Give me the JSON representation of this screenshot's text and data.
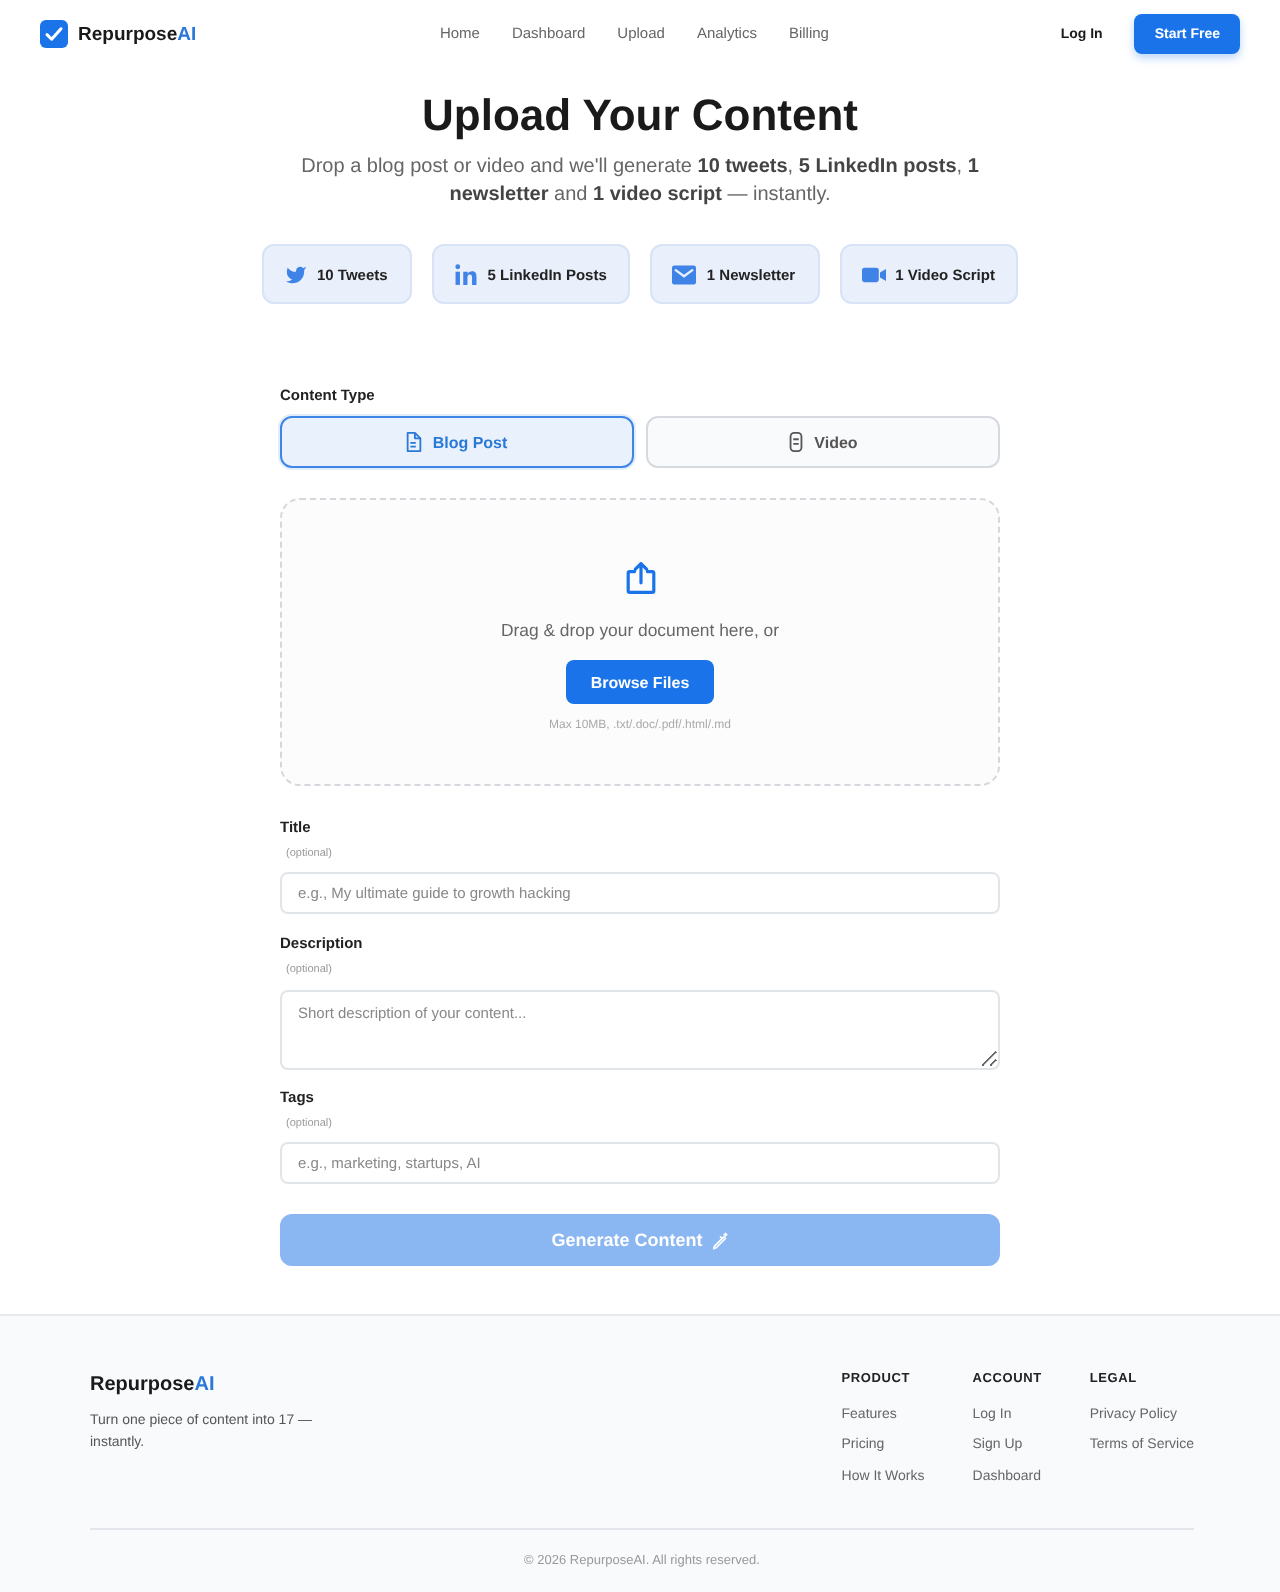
{
  "header": {
    "brand": {
      "name": "Repurpose",
      "accent": "AI"
    },
    "nav": [
      "Home",
      "Dashboard",
      "Upload",
      "Analytics",
      "Billing"
    ],
    "login": "Log In",
    "cta": "Start Free"
  },
  "hero": {
    "title": "Upload Your Content",
    "subtitle": "Drop a blog post or video and we'll generate **10 tweets**, **5 LinkedIn posts**, **1 newsletter** and **1 video script** — instantly.",
    "outputs": [
      {
        "kind": "twitter",
        "label": "10 Tweets"
      },
      {
        "kind": "linkedin",
        "label": "5 LinkedIn Posts"
      },
      {
        "kind": "email",
        "label": "1 Newsletter"
      },
      {
        "kind": "video",
        "label": "1 Video Script"
      }
    ]
  },
  "form": {
    "content_type": {
      "label": "Content Type",
      "options": [
        {
          "kind": "document",
          "label": "Blog Post",
          "selected": true
        },
        {
          "kind": "video",
          "label": "Video",
          "selected": false
        }
      ]
    },
    "dropzone": {
      "prompt": "Drag & drop your document here, or",
      "button": "Browse Files",
      "hint": "Max 10MB, .txt/.doc/.pdf/.html/.md"
    },
    "fields": [
      {
        "kind": "input",
        "label": "Title",
        "note": "(optional)",
        "placeholder": "e.g., My ultimate guide to growth hacking"
      },
      {
        "kind": "textarea",
        "label": "Description",
        "note": "(optional)",
        "placeholder": "Short description of your content..."
      },
      {
        "kind": "input",
        "label": "Tags",
        "note": "(optional)",
        "placeholder": "e.g., marketing, startups, AI"
      }
    ],
    "submit": {
      "label": "Generate Content",
      "disabled": true
    }
  },
  "footer": {
    "brand": {
      "name": "Repurpose",
      "accent": "AI"
    },
    "tagline": "Turn one piece of content into 17 — instantly.",
    "columns": [
      {
        "heading": "PRODUCT",
        "links": [
          "Features",
          "Pricing",
          "How It Works"
        ]
      },
      {
        "heading": "ACCOUNT",
        "links": [
          "Log In",
          "Sign Up",
          "Dashboard"
        ]
      },
      {
        "heading": "LEGAL",
        "links": [
          "Privacy Policy",
          "Terms of Service"
        ]
      }
    ],
    "copyright": "© 2026 RepurposeAI. All rights reserved."
  }
}
